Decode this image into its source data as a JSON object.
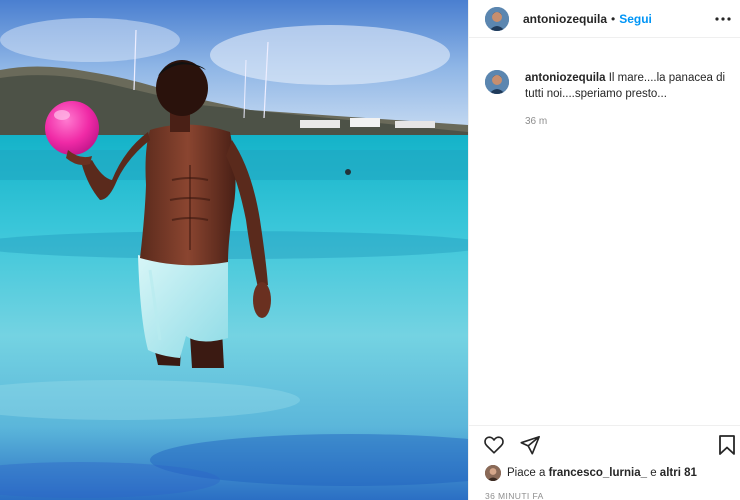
{
  "post": {
    "username": "antoniozequila",
    "separator": "•",
    "follow_label": "Segui"
  },
  "caption": {
    "username": "antoniozequila",
    "text": " Il mare....la panacea di tutti noi....speriamo presto...",
    "time": "36 m"
  },
  "likes": {
    "prefix": "Piace a ",
    "first_liker": "francesco_lurnia_",
    "middle": " e ",
    "rest": "altri 81"
  },
  "date_label": "36 MINUTI FA",
  "icons": {
    "more": "more-options-icon",
    "like": "heart-icon",
    "share": "paper-plane-icon",
    "save": "bookmark-icon"
  },
  "colors": {
    "link_blue": "#0095f6",
    "muted_gray": "#8e8e8e",
    "text": "#262626",
    "ball_magenta": "#ff2ea8",
    "sea_turquoise": "#2fb5cf"
  }
}
